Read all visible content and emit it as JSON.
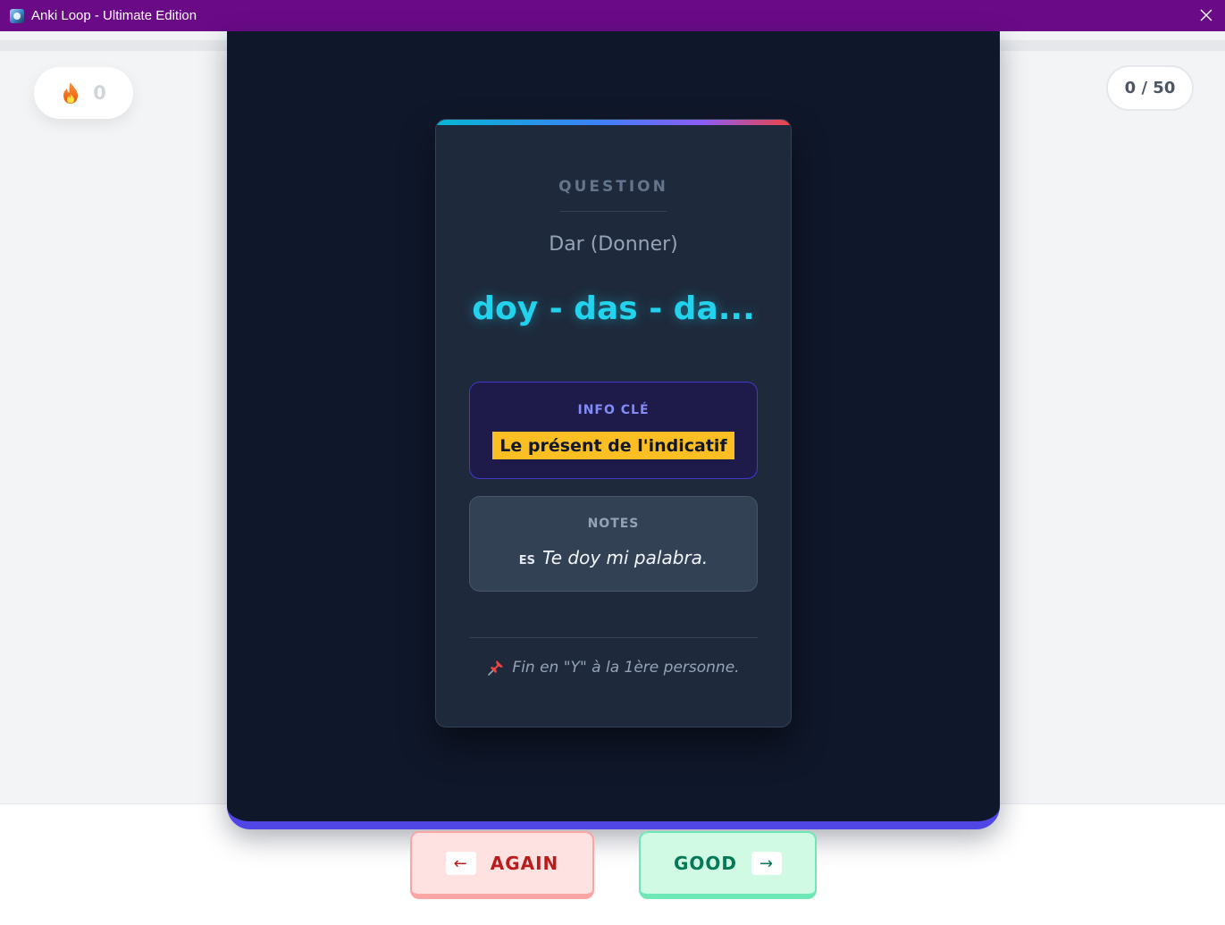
{
  "window": {
    "title": "Anki Loop - Ultimate Edition",
    "app_icon": "anki-app-icon",
    "close_icon": "close-icon"
  },
  "progress": {
    "fraction": 0.0
  },
  "streak": {
    "icon": "fire-icon",
    "count": "0"
  },
  "counter": {
    "text": "0 / 50"
  },
  "card": {
    "question_label": "QUESTION",
    "verb": "Dar (Donner)",
    "answer": "doy - das - da...",
    "info": {
      "label": "INFO CLÉ",
      "value": "Le présent de l'indicatif"
    },
    "notes": {
      "label": "NOTES",
      "lang": "ES",
      "example": "Te doy mi palabra."
    },
    "tip": {
      "icon": "pushpin-icon",
      "text": "Fin en \"Y\" à la 1ère personne."
    }
  },
  "actions": {
    "again": {
      "label": "AGAIN",
      "key": "←"
    },
    "good": {
      "label": "GOOD",
      "key": "→"
    }
  },
  "colors": {
    "titlebar": "#6b0a87",
    "stage": "#0f172a",
    "card": "#1e293b",
    "answer": "#22d3ee",
    "highlight": "#fbbf24",
    "accent": "#4f46e5",
    "again": "#b91c1c",
    "good": "#047857"
  }
}
